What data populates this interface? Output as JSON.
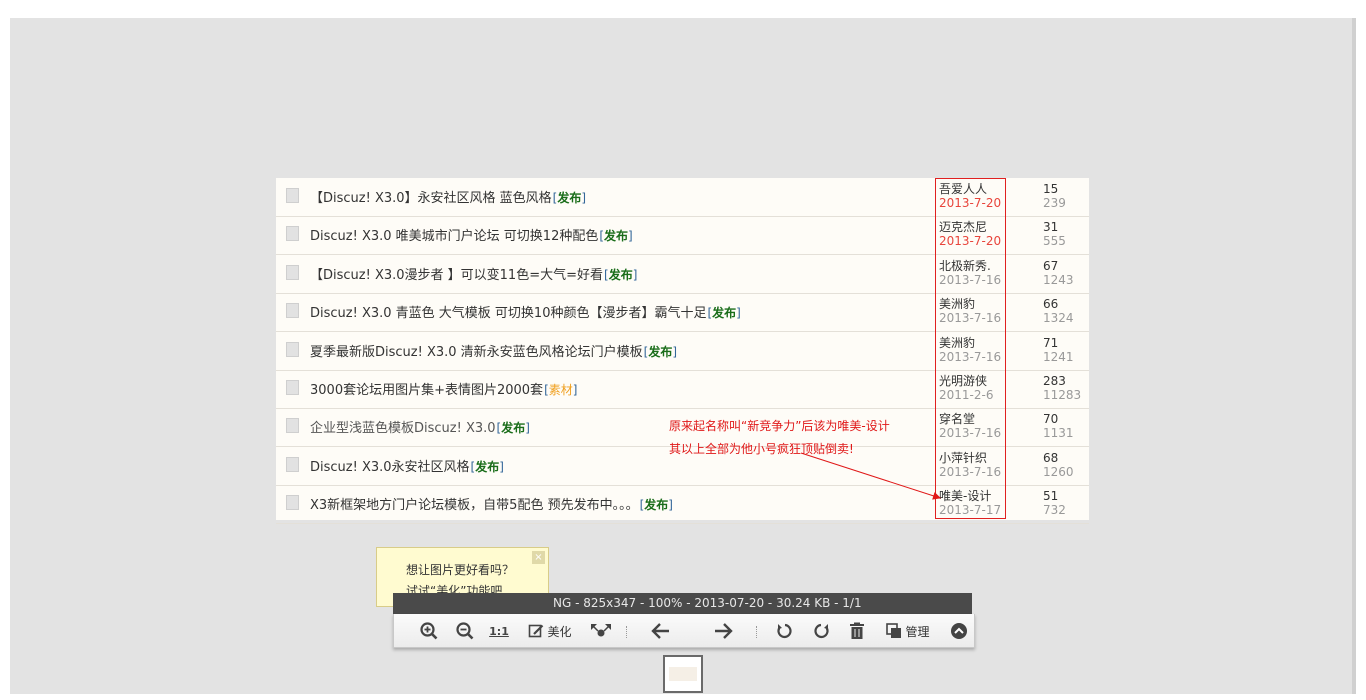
{
  "rows": [
    {
      "title": "【Discuz! X3.0】永安社区风格 蓝色风格",
      "tag": "发布",
      "author": "吾爱人人",
      "date": "2013-7-20",
      "replies": "15",
      "views": "239"
    },
    {
      "title": "Discuz! X3.0 唯美城市门户论坛 可切换12种配色",
      "tag": "发布",
      "author": "迈克杰尼",
      "date": "2013-7-20",
      "replies": "31",
      "views": "555"
    },
    {
      "title": "【Discuz! X3.0漫步者 】可以变11色=大气=好看",
      "tag": "发布",
      "author": "北极新秀.",
      "date": "2013-7-16",
      "replies": "67",
      "views": "1243"
    },
    {
      "title": "Discuz! X3.0 青蓝色 大气模板 可切换10种颜色【漫步者】霸气十足",
      "tag": "发布",
      "author": "美洲豹",
      "date": "2013-7-16",
      "replies": "66",
      "views": "1324"
    },
    {
      "title": "夏季最新版Discuz! X3.0 清新永安蓝色风格论坛门户模板",
      "tag": "发布",
      "author": "美洲豹",
      "date": "2013-7-16",
      "replies": "71",
      "views": "1241"
    },
    {
      "title": "3000套论坛用图片集+表情图片2000套",
      "tag": "素材",
      "author": "光明游侠",
      "date": "2011-2-6",
      "replies": "283",
      "views": "11283"
    },
    {
      "title": "企业型浅蓝色模板Discuz! X3.0",
      "tag": "发布",
      "author": "穿名堂",
      "date": "2013-7-16",
      "replies": "70",
      "views": "1131"
    },
    {
      "title": "Discuz! X3.0永安社区风格",
      "tag": "发布",
      "author": "小萍针织",
      "date": "2013-7-16",
      "replies": "68",
      "views": "1260"
    },
    {
      "title": "X3新框架地方门户论坛模板，自带5配色 预先发布中。。。",
      "tag": "发布",
      "author": "唯美-设计",
      "date": "2013-7-17",
      "replies": "51",
      "views": "732"
    }
  ],
  "annotation": {
    "line1": "原来起名称叫“新竞争力”后该为唯美-设计",
    "line2": "其以上全部为他小号疯狂顶贴倒卖!"
  },
  "tip": {
    "line1": "想让图片更好看吗？",
    "line2": "试试“美化”功能吧",
    "close": "×"
  },
  "infobar": "NG - 825x347 - 100% - 2013-07-20 - 30.24 KB - 1/1",
  "toolbar": {
    "actual_size": "1:1",
    "beautify": "美化",
    "manage": "管理"
  },
  "colors": {
    "tag_green": "#1a6d1a",
    "tag_orange": "#f0a020",
    "date_red": "#e8453c",
    "annotation_red": "#e01818"
  }
}
